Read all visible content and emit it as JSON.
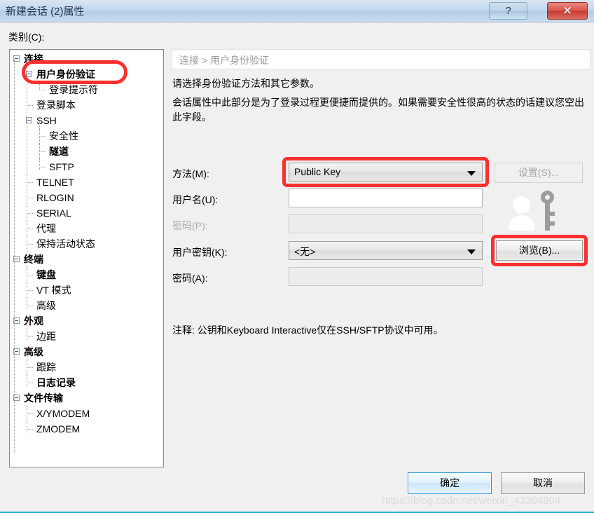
{
  "window": {
    "title": "新建会话 (2)属性",
    "help_button": "?",
    "close_button": "✕"
  },
  "category": {
    "label": "类别(C):",
    "tree": [
      {
        "label": "连接",
        "depth": 0,
        "bold": true,
        "expander": true,
        "eng": false
      },
      {
        "label": "用户身份验证",
        "depth": 1,
        "bold": true,
        "expander": true,
        "eng": false
      },
      {
        "label": "登录提示符",
        "depth": 2,
        "bold": false,
        "expander": false,
        "eng": false
      },
      {
        "label": "登录脚本",
        "depth": 1,
        "bold": false,
        "expander": false,
        "eng": false
      },
      {
        "label": "SSH",
        "depth": 1,
        "bold": false,
        "expander": true,
        "eng": true
      },
      {
        "label": "安全性",
        "depth": 2,
        "bold": false,
        "expander": false,
        "eng": false
      },
      {
        "label": "隧道",
        "depth": 2,
        "bold": true,
        "expander": false,
        "eng": false
      },
      {
        "label": "SFTP",
        "depth": 2,
        "bold": false,
        "expander": false,
        "eng": true
      },
      {
        "label": "TELNET",
        "depth": 1,
        "bold": false,
        "expander": false,
        "eng": true
      },
      {
        "label": "RLOGIN",
        "depth": 1,
        "bold": false,
        "expander": false,
        "eng": true
      },
      {
        "label": "SERIAL",
        "depth": 1,
        "bold": false,
        "expander": false,
        "eng": true
      },
      {
        "label": "代理",
        "depth": 1,
        "bold": false,
        "expander": false,
        "eng": false
      },
      {
        "label": "保持活动状态",
        "depth": 1,
        "bold": false,
        "expander": false,
        "eng": false
      },
      {
        "label": "终端",
        "depth": 0,
        "bold": true,
        "expander": true,
        "eng": false
      },
      {
        "label": "键盘",
        "depth": 1,
        "bold": true,
        "expander": false,
        "eng": false
      },
      {
        "label": "VT 模式",
        "depth": 1,
        "bold": false,
        "expander": false,
        "eng": false
      },
      {
        "label": "高级",
        "depth": 1,
        "bold": false,
        "expander": false,
        "eng": false
      },
      {
        "label": "外观",
        "depth": 0,
        "bold": true,
        "expander": true,
        "eng": false
      },
      {
        "label": "边距",
        "depth": 1,
        "bold": false,
        "expander": false,
        "eng": false
      },
      {
        "label": "高级",
        "depth": 0,
        "bold": true,
        "expander": true,
        "eng": false
      },
      {
        "label": "跟踪",
        "depth": 1,
        "bold": false,
        "expander": false,
        "eng": false
      },
      {
        "label": "日志记录",
        "depth": 1,
        "bold": true,
        "expander": false,
        "eng": false
      },
      {
        "label": "文件传输",
        "depth": 0,
        "bold": true,
        "expander": true,
        "eng": false
      },
      {
        "label": "X/YMODEM",
        "depth": 1,
        "bold": false,
        "expander": false,
        "eng": true
      },
      {
        "label": "ZMODEM",
        "depth": 1,
        "bold": false,
        "expander": false,
        "eng": true
      }
    ]
  },
  "pane": {
    "breadcrumb": "连接 > 用户身份验证",
    "description_line1": "请选择身份验证方法和其它参数。",
    "description_line2": "会话属性中此部分是为了登录过程更便捷而提供的。如果需要安全性很高的状态的话建议您空出此字段。",
    "note": "注释: 公钥和Keyboard Interactive仅在SSH/SFTP协议中可用。",
    "fields": {
      "method": {
        "label": "方法(M):",
        "value": "Public Key"
      },
      "username": {
        "label": "用户名(U):",
        "value": "",
        "placeholder": ""
      },
      "password": {
        "label": "密码(P):",
        "value": "",
        "placeholder": "",
        "disabled": true
      },
      "userkey": {
        "label": "用户密钥(K):",
        "value": "<无>"
      },
      "passphrase": {
        "label": "密码(A):",
        "value": "",
        "placeholder": "",
        "disabled": true
      }
    },
    "buttons": {
      "settings": "设置(S)...",
      "browse": "浏览(B)..."
    }
  },
  "footer": {
    "ok": "确定",
    "cancel": "取消"
  },
  "watermark": "https://blog.csdn.net/weixin_43304804",
  "annotations": {
    "accent_color": "#f8302f"
  }
}
